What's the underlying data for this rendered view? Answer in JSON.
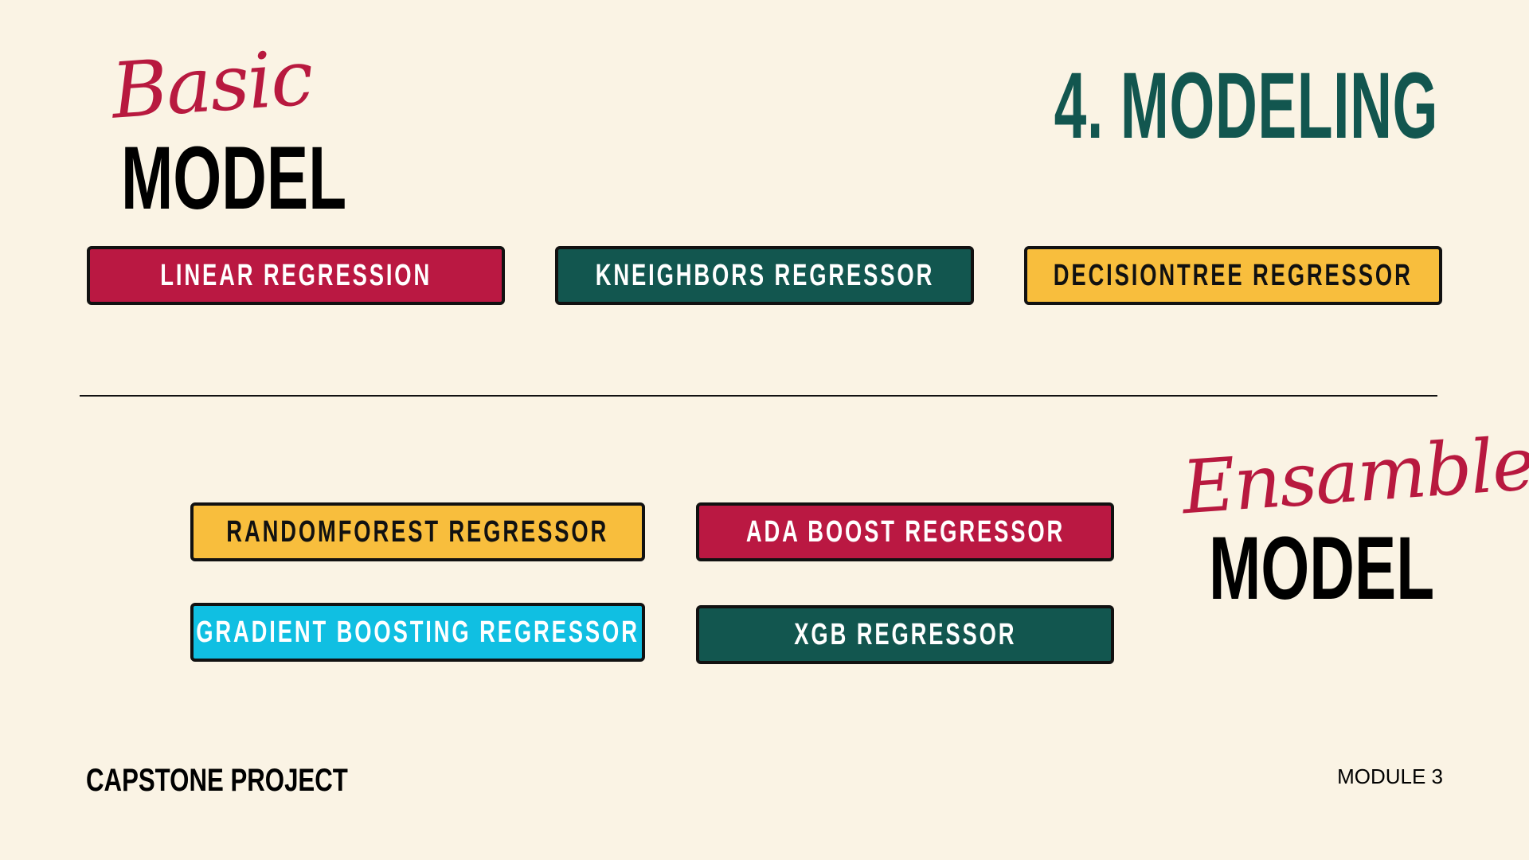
{
  "title": "4. MODELING",
  "basic_section": {
    "script_word": "Basic",
    "model_word": "MODEL",
    "models": [
      "LINEAR REGRESSION",
      "KNEIGHBORS REGRESSOR",
      "DECISIONTREE REGRESSOR"
    ]
  },
  "ensemble_section": {
    "script_word": "Ensamble",
    "model_word": "MODEL",
    "models": [
      "RANDOMFOREST REGRESSOR",
      "ADA BOOST REGRESSOR",
      "GRADIENT BOOSTING REGRESSOR",
      "XGB REGRESSOR"
    ]
  },
  "footer": {
    "left": "CAPSTONE PROJECT",
    "right": "MODULE 3"
  },
  "colors": {
    "background": "#FAF3E4",
    "teal": "#12564F",
    "red": "#BA1842",
    "yellow": "#F8BE3D",
    "cyan": "#10BFE2"
  }
}
